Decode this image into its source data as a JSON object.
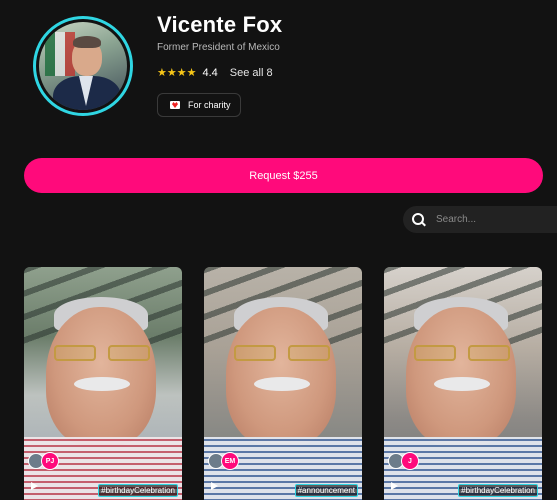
{
  "profile": {
    "name": "Vicente Fox",
    "subtitle": "Former President of Mexico",
    "rating_stars": "★★★★",
    "rating_value": "4.4",
    "see_all": "See all 8",
    "charity_label": "For charity"
  },
  "request_button": "Request $255",
  "search": {
    "placeholder": "Search..."
  },
  "videos": [
    {
      "initials": "PJ",
      "tag": "#birthdayCelebration"
    },
    {
      "initials": "EM",
      "tag": "#announcement"
    },
    {
      "initials": "J",
      "tag": "#birthdayCelebration"
    }
  ],
  "colors": {
    "accent": "#ff0a7b",
    "ring": "#2fd6e3",
    "background": "#121212"
  }
}
